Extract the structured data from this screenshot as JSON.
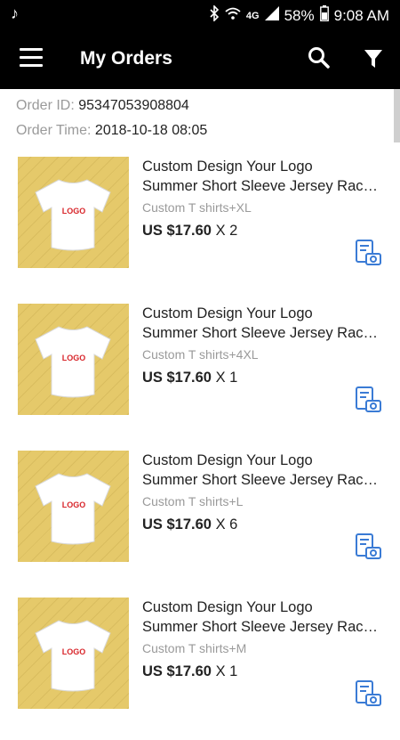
{
  "status_bar": {
    "time": "9:08 AM",
    "battery": "58%",
    "network": "4G"
  },
  "app_bar": {
    "title": "My Orders"
  },
  "order": {
    "id_label": "Order ID:",
    "id": "95347053908804",
    "time_label": "Order Time:",
    "time": "2018-10-18 08:05"
  },
  "items": [
    {
      "title_line1": "Custom Design Your Logo",
      "title_line2": "Summer Short Sleeve Jersey Rac…",
      "variant": "Custom T shirts+XL",
      "price": "US $17.60",
      "qty": "X 2",
      "logo_text": "LOGO"
    },
    {
      "title_line1": "Custom Design Your Logo",
      "title_line2": "Summer Short Sleeve Jersey Rac…",
      "variant": "Custom T shirts+4XL",
      "price": "US $17.60",
      "qty": "X 1",
      "logo_text": "LOGO"
    },
    {
      "title_line1": "Custom Design Your Logo",
      "title_line2": "Summer Short Sleeve Jersey Rac…",
      "variant": "Custom T shirts+L",
      "price": "US $17.60",
      "qty": "X 6",
      "logo_text": "LOGO"
    },
    {
      "title_line1": "Custom Design Your Logo",
      "title_line2": "Summer Short Sleeve Jersey Rac…",
      "variant": "Custom T shirts+M",
      "price": "US $17.60",
      "qty": "X 1",
      "logo_text": "LOGO"
    }
  ],
  "colors": {
    "header_bg": "#000000",
    "accent_icon": "#3a7bd5",
    "thumb_bg": "#e5c96a",
    "logo_red": "#d8262b"
  },
  "icons": {
    "menu": "hamburger-icon",
    "search": "search-icon",
    "filter": "filter-icon",
    "review": "photo-review-icon",
    "music": "music-note-icon",
    "bluetooth": "bluetooth-icon",
    "wifi": "wifi-icon",
    "signal": "signal-icon",
    "battery": "battery-icon"
  }
}
